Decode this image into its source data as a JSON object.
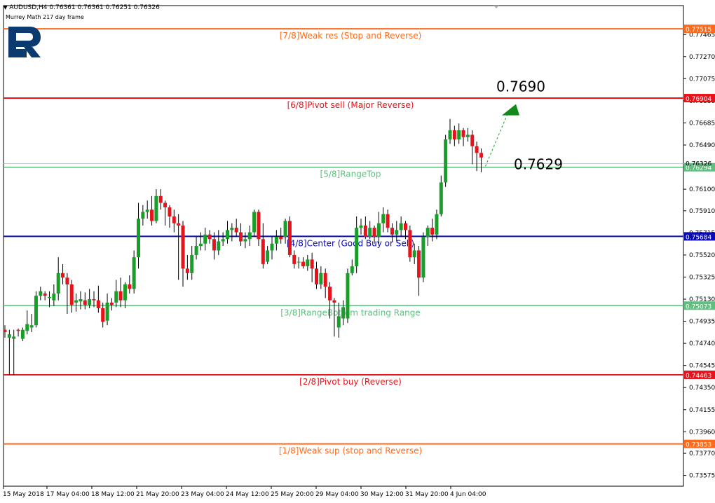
{
  "chart_data": {
    "type": "candlestick",
    "symbol_header": "AUDUSD,H4  0.76361 0.76361 0.76251 0.76326",
    "subtitle": "Murrey Math 217 day frame",
    "ylim": [
      0.7348,
      0.7772
    ],
    "y_ticks": [
      "0.77465",
      "0.77270",
      "0.77075",
      "0.76880",
      "0.76685",
      "0.76490",
      "0.76295",
      "0.76100",
      "0.75910",
      "0.75715",
      "0.75520",
      "0.75325",
      "0.75130",
      "0.74935",
      "0.74740",
      "0.74545",
      "0.74350",
      "0.74155",
      "0.73960",
      "0.73770",
      "0.73575"
    ],
    "x_ticks": [
      "15 May 2018",
      "17 May 04:00",
      "18 May 12:00",
      "21 May 20:00",
      "23 May 04:00",
      "24 May 12:00",
      "25 May 20:00",
      "29 May 04:00",
      "30 May 12:00",
      "31 May 20:00",
      "4 Jun 04:00"
    ],
    "current_price_label": "0.76326",
    "levels": [
      {
        "value": 0.77515,
        "label": "[7/8]Weak res (Stop and Reverse)",
        "price_label": "0.77515",
        "color": "#ff6a1a"
      },
      {
        "value": 0.76904,
        "label": "[6/8]Pivot sell (Major Reverse)",
        "price_label": "0.76904",
        "color": "#e8131a"
      },
      {
        "value": 0.76294,
        "label": "[5/8]RangeTop",
        "price_label": "0.76294",
        "color": "#5fbf7f"
      },
      {
        "value": 0.75684,
        "label": "[4/8]Center (Good Buy or Sell)",
        "price_label": "0.75684",
        "color": "#0a0ab4"
      },
      {
        "value": 0.75073,
        "label": "[3/8]RangeBottom trading Range",
        "price_label": "0.75073",
        "color": "#5fbf7f"
      },
      {
        "value": 0.74463,
        "label": "[2/8]Pivot buy (Reverse)",
        "price_label": "0.74463",
        "color": "#e8131a"
      },
      {
        "value": 0.73853,
        "label": "[1/8]Weak sup (stop and Reverse)",
        "price_label": "0.73853",
        "color": "#ff6a1a"
      }
    ],
    "annotations": [
      {
        "text": "0.7690",
        "value": 0.769
      },
      {
        "text": "0.7629",
        "value": 0.7629
      }
    ],
    "candles": [
      [
        0.7486,
        0.7484,
        0.749,
        0.7479
      ],
      [
        0.7479,
        0.7482,
        0.7486,
        0.7446
      ],
      [
        0.7478,
        0.748,
        0.7486,
        0.7446
      ],
      [
        0.7486,
        0.7485,
        0.7487,
        0.748
      ],
      [
        0.7478,
        0.7486,
        0.7488,
        0.7476
      ],
      [
        0.7485,
        0.7491,
        0.7503,
        0.7482
      ],
      [
        0.7488,
        0.749,
        0.75,
        0.7484
      ],
      [
        0.749,
        0.7516,
        0.752,
        0.7488
      ],
      [
        0.7516,
        0.752,
        0.7524,
        0.7512
      ],
      [
        0.7518,
        0.7516,
        0.752,
        0.7512
      ],
      [
        0.7514,
        0.7515,
        0.752,
        0.7506
      ],
      [
        0.7512,
        0.7518,
        0.7526,
        0.7507
      ],
      [
        0.7518,
        0.7536,
        0.755,
        0.7512
      ],
      [
        0.7536,
        0.7532,
        0.7544,
        0.7526
      ],
      [
        0.7532,
        0.7526,
        0.7536,
        0.75
      ],
      [
        0.7526,
        0.7508,
        0.753,
        0.7501
      ],
      [
        0.751,
        0.7512,
        0.7518,
        0.7502
      ],
      [
        0.7511,
        0.7513,
        0.752,
        0.7504
      ],
      [
        0.7512,
        0.7508,
        0.7519,
        0.7504
      ],
      [
        0.7508,
        0.7513,
        0.7522,
        0.7505
      ],
      [
        0.7513,
        0.7512,
        0.752,
        0.7506
      ],
      [
        0.7512,
        0.7505,
        0.7525,
        0.7501
      ],
      [
        0.7505,
        0.7493,
        0.751,
        0.7488
      ],
      [
        0.7494,
        0.751,
        0.7518,
        0.749
      ],
      [
        0.751,
        0.7508,
        0.7514,
        0.7503
      ],
      [
        0.751,
        0.752,
        0.753,
        0.7506
      ],
      [
        0.752,
        0.7512,
        0.7532,
        0.7506
      ],
      [
        0.7512,
        0.7526,
        0.7528,
        0.7505
      ],
      [
        0.7526,
        0.7522,
        0.7534,
        0.7518
      ],
      [
        0.7522,
        0.755,
        0.7556,
        0.7518
      ],
      [
        0.755,
        0.7584,
        0.7598,
        0.754
      ],
      [
        0.7584,
        0.759,
        0.7596,
        0.7578
      ],
      [
        0.759,
        0.7592,
        0.76,
        0.7584
      ],
      [
        0.7592,
        0.7582,
        0.7604,
        0.7578
      ],
      [
        0.7582,
        0.7604,
        0.761,
        0.758
      ],
      [
        0.7604,
        0.7598,
        0.761,
        0.7592
      ],
      [
        0.7598,
        0.7594,
        0.76,
        0.7578
      ],
      [
        0.7594,
        0.7586,
        0.7596,
        0.7576
      ],
      [
        0.7586,
        0.758,
        0.7592,
        0.7572
      ],
      [
        0.758,
        0.7578,
        0.7588,
        0.753
      ],
      [
        0.7578,
        0.754,
        0.7582,
        0.7524
      ],
      [
        0.754,
        0.7536,
        0.7552,
        0.753
      ],
      [
        0.7536,
        0.7552,
        0.756,
        0.753
      ],
      [
        0.7552,
        0.756,
        0.7568,
        0.7548
      ],
      [
        0.756,
        0.7562,
        0.7572,
        0.7556
      ],
      [
        0.7562,
        0.757,
        0.7576,
        0.7556
      ],
      [
        0.757,
        0.7566,
        0.7574,
        0.7562
      ],
      [
        0.7566,
        0.7556,
        0.7572,
        0.7548
      ],
      [
        0.7556,
        0.7564,
        0.7574,
        0.7552
      ],
      [
        0.7564,
        0.7566,
        0.7572,
        0.756
      ],
      [
        0.7566,
        0.7574,
        0.7582,
        0.7562
      ],
      [
        0.7574,
        0.7576,
        0.758,
        0.7564
      ],
      [
        0.7576,
        0.7572,
        0.7584,
        0.7568
      ],
      [
        0.7572,
        0.7564,
        0.758,
        0.756
      ],
      [
        0.7564,
        0.7566,
        0.7572,
        0.7558
      ],
      [
        0.7566,
        0.7572,
        0.7578,
        0.756
      ],
      [
        0.7572,
        0.759,
        0.7592,
        0.7568
      ],
      [
        0.759,
        0.7566,
        0.7592,
        0.756
      ],
      [
        0.7566,
        0.7544,
        0.758,
        0.754
      ],
      [
        0.7546,
        0.7556,
        0.756,
        0.7544
      ],
      [
        0.7556,
        0.7562,
        0.7568,
        0.7548
      ],
      [
        0.7562,
        0.7568,
        0.7574,
        0.7556
      ],
      [
        0.7568,
        0.7566,
        0.7576,
        0.7562
      ],
      [
        0.7568,
        0.7582,
        0.7584,
        0.7562
      ],
      [
        0.7582,
        0.7552,
        0.7586,
        0.755
      ],
      [
        0.7552,
        0.7544,
        0.7556,
        0.754
      ],
      [
        0.7546,
        0.7546,
        0.755,
        0.754
      ],
      [
        0.7546,
        0.7542,
        0.755,
        0.754
      ],
      [
        0.7542,
        0.7548,
        0.7552,
        0.7538
      ],
      [
        0.7548,
        0.754,
        0.7554,
        0.7528
      ],
      [
        0.754,
        0.7526,
        0.7546,
        0.7522
      ],
      [
        0.7526,
        0.7536,
        0.7542,
        0.7522
      ],
      [
        0.7536,
        0.7524,
        0.754,
        0.7514
      ],
      [
        0.7524,
        0.7512,
        0.7528,
        0.7496
      ],
      [
        0.7512,
        0.751,
        0.7514,
        0.748
      ],
      [
        0.7488,
        0.7498,
        0.751,
        0.7479
      ],
      [
        0.7496,
        0.7506,
        0.7512,
        0.749
      ],
      [
        0.7496,
        0.7536,
        0.754,
        0.7492
      ],
      [
        0.7536,
        0.7542,
        0.7548,
        0.7534
      ],
      [
        0.7542,
        0.7576,
        0.7586,
        0.7536
      ],
      [
        0.7576,
        0.7578,
        0.7584,
        0.757
      ],
      [
        0.7578,
        0.7568,
        0.7586,
        0.7566
      ],
      [
        0.7568,
        0.7576,
        0.7582,
        0.7566
      ],
      [
        0.7576,
        0.7568,
        0.7578,
        0.7562
      ],
      [
        0.7568,
        0.758,
        0.759,
        0.7562
      ],
      [
        0.758,
        0.7588,
        0.7594,
        0.7572
      ],
      [
        0.7588,
        0.7576,
        0.7592,
        0.7572
      ],
      [
        0.7576,
        0.757,
        0.758,
        0.7564
      ],
      [
        0.757,
        0.7574,
        0.7582,
        0.7564
      ],
      [
        0.7574,
        0.758,
        0.7586,
        0.7568
      ],
      [
        0.758,
        0.7574,
        0.7582,
        0.7566
      ],
      [
        0.7574,
        0.755,
        0.7578,
        0.7546
      ],
      [
        0.755,
        0.7556,
        0.7562,
        0.7544
      ],
      [
        0.7556,
        0.7532,
        0.756,
        0.7516
      ],
      [
        0.7532,
        0.7568,
        0.7572,
        0.7528
      ],
      [
        0.7568,
        0.7576,
        0.7578,
        0.756
      ],
      [
        0.7576,
        0.757,
        0.7584,
        0.7564
      ],
      [
        0.757,
        0.7588,
        0.7592,
        0.7566
      ],
      [
        0.7588,
        0.7616,
        0.7622,
        0.7586
      ],
      [
        0.7616,
        0.7654,
        0.7658,
        0.7612
      ],
      [
        0.7654,
        0.7662,
        0.7672,
        0.765
      ],
      [
        0.7662,
        0.7654,
        0.7666,
        0.7648
      ],
      [
        0.7654,
        0.7662,
        0.7668,
        0.765
      ],
      [
        0.7662,
        0.7656,
        0.7664,
        0.7648
      ],
      [
        0.7656,
        0.7658,
        0.7664,
        0.7652
      ],
      [
        0.7658,
        0.7648,
        0.7662,
        0.7632
      ],
      [
        0.7648,
        0.7642,
        0.7652,
        0.7626
      ],
      [
        0.7642,
        0.7638,
        0.7646,
        0.7625
      ]
    ]
  }
}
